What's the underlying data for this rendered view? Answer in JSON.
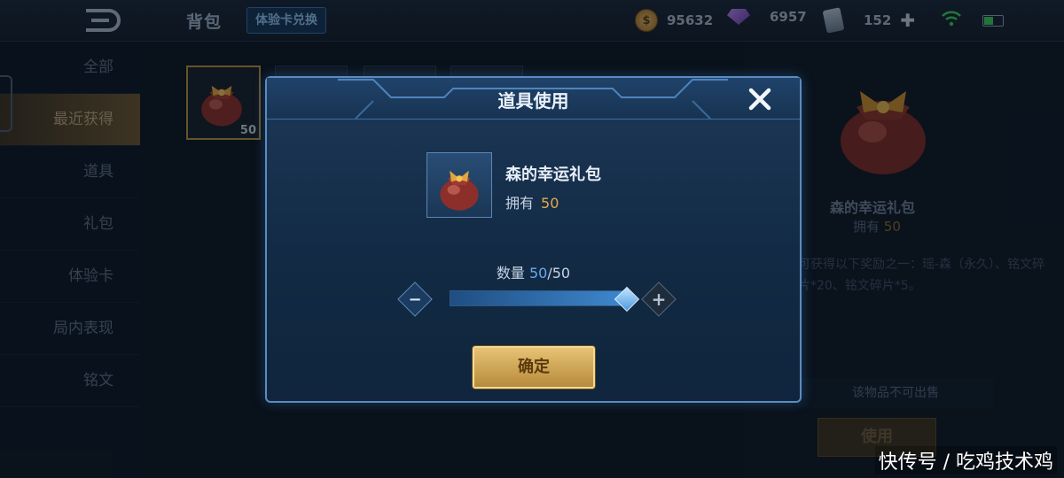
{
  "header": {
    "title": "背包",
    "card_redeem": "体验卡兑换",
    "coins": "95632",
    "gems": "6957",
    "cards": "152"
  },
  "sidebar": {
    "items": [
      {
        "label": "全部"
      },
      {
        "label": "最近获得"
      },
      {
        "label": "道具"
      },
      {
        "label": "礼包"
      },
      {
        "label": "体验卡"
      },
      {
        "label": "局内表现"
      },
      {
        "label": "铭文"
      }
    ],
    "active_index": 1
  },
  "grid": {
    "selected_count": "50"
  },
  "detail": {
    "name": "森的幸运礼包",
    "own_label": "拥有",
    "own_count": "50",
    "description": "可获得以下奖励之一：瑶-森（永久）、铭文碎片*20、铭文碎片*5。",
    "not_sellable": "该物品不可出售",
    "use_label": "使用"
  },
  "dialog": {
    "title": "道具使用",
    "item_name": "森的幸运礼包",
    "own_label": "拥有",
    "own_count": "50",
    "qty_label": "数量",
    "qty_current": "50",
    "qty_max": "/50",
    "qty_fraction": 1.0,
    "confirm_label": "确定"
  },
  "watermark": "快传号 / 吃鸡技术鸡",
  "colors": {
    "accent_gold": "#e3a947",
    "accent_blue": "#6aa9ec",
    "dialog_border": "#5a8cc0"
  }
}
